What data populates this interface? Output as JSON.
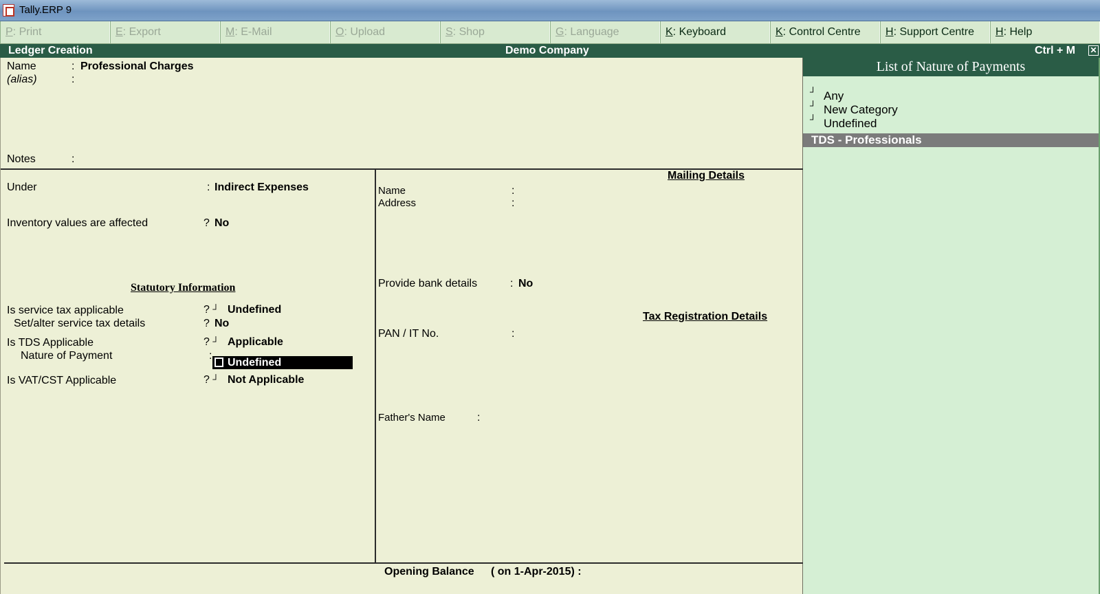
{
  "window": {
    "title": "Tally.ERP 9"
  },
  "button_bar": [
    {
      "key": "P",
      "label": "Print",
      "enabled": false
    },
    {
      "key": "E",
      "label": "Export",
      "enabled": false
    },
    {
      "key": "M",
      "label": "E-Mail",
      "enabled": false
    },
    {
      "key": "O",
      "label": "Upload",
      "enabled": false
    },
    {
      "key": "S",
      "label": "Shop",
      "enabled": false
    },
    {
      "key": "G",
      "label": "Language",
      "enabled": false
    },
    {
      "key": "K",
      "label": "Keyboard",
      "enabled": true
    },
    {
      "key": "K",
      "label": "Control Centre",
      "enabled": true
    },
    {
      "key": "H",
      "label": "Support Centre",
      "enabled": true
    },
    {
      "key": "H",
      "label": "Help",
      "enabled": true
    }
  ],
  "header": {
    "screen": "Ledger Creation",
    "company": "Demo Company",
    "shortcut": "Ctrl + M",
    "close_icon": "close-icon"
  },
  "form": {
    "name_label": "Name",
    "name_value": "Professional Charges",
    "alias_label": "(alias)",
    "notes_label": "Notes",
    "colon": ":",
    "under_label": "Under",
    "under_value": "Indirect Expenses",
    "inventory_label": "Inventory values are affected",
    "inventory_value": "No",
    "statutory_heading": "Statutory Information",
    "service_tax_label": "Is service tax applicable",
    "service_tax_value": "Undefined",
    "set_alter_label": "Set/alter service tax details",
    "set_alter_value": "No",
    "tds_label": "Is TDS Applicable",
    "tds_value": "Applicable",
    "nature_label": "Nature of Payment",
    "nature_value": "Undefined",
    "vat_label": "Is VAT/CST Applicable",
    "vat_value": "Not Applicable",
    "q": "?"
  },
  "mailing": {
    "heading": "Mailing Details",
    "name_label": "Name",
    "address_label": "Address",
    "bank_label": "Provide bank details",
    "bank_value": "No",
    "tax_heading": "Tax Registration Details",
    "pan_label": "PAN / IT No.",
    "father_label": "Father's Name"
  },
  "footer": {
    "opening_balance": "Opening Balance",
    "on_date": "( on 1-Apr-2015) :"
  },
  "list": {
    "title": "List of Nature of Payments",
    "items": [
      "Any",
      "New Category",
      "Undefined"
    ],
    "selected": "TDS - Professionals"
  }
}
